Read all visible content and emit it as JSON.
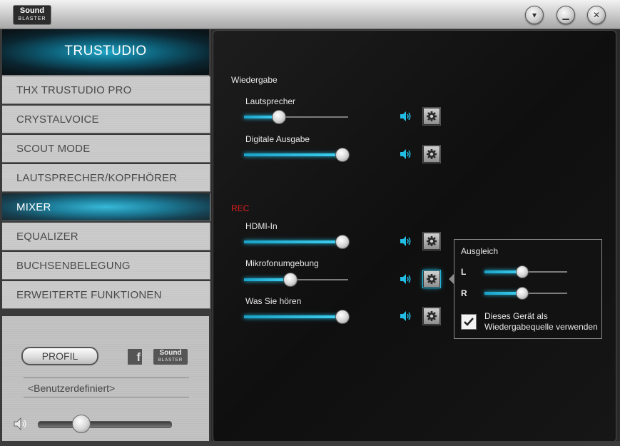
{
  "titlebar": {
    "logo_line1": "Sound",
    "logo_line2": "BLASTER",
    "buttons": [
      "▾",
      "▁",
      "✕"
    ]
  },
  "sidebar": {
    "header": "TRUSTUDIO",
    "items": [
      {
        "label": "THX TRUSTUDIO PRO",
        "active": false
      },
      {
        "label": "CRYSTALVOICE",
        "active": false
      },
      {
        "label": "SCOUT MODE",
        "active": false
      },
      {
        "label": "LAUTSPRECHER/KOPFHÖRER",
        "active": false
      },
      {
        "label": "MIXER",
        "active": true
      },
      {
        "label": "EQUALIZER",
        "active": false
      },
      {
        "label": "BUCHSENBELEGUNG",
        "active": false
      },
      {
        "label": "ERWEITERTE FUNKTIONEN",
        "active": false
      }
    ],
    "profile_label": "PROFIL",
    "facebook_letter": "f",
    "sb_logo_line1": "Sound",
    "sb_logo_line2": "BLASTER",
    "preset_value": "<Benutzerdefiniert>",
    "master_volume": 0.32
  },
  "mixer": {
    "playback_title": "Wiedergabe",
    "record_title": "REC",
    "playback": [
      {
        "label": "Lautsprecher",
        "level": 0.33
      },
      {
        "label": "Digitale Ausgabe",
        "level": 0.94
      }
    ],
    "record": [
      {
        "label": "HDMI-In",
        "level": 0.94
      },
      {
        "label": "Mikrofonumgebung",
        "level": 0.44
      },
      {
        "label": "Was Sie hören",
        "level": 0.94
      }
    ]
  },
  "balance_popup": {
    "title": "Ausgleich",
    "left_label": "L",
    "right_label": "R",
    "left_level": 0.45,
    "right_level": 0.45,
    "checkbox_checked": true,
    "checkbox_label": "Dieses Gerät als Wiedergabequelle verwenden"
  },
  "colors": {
    "accent": "#22bde4",
    "rec_label": "#e01e1e"
  }
}
